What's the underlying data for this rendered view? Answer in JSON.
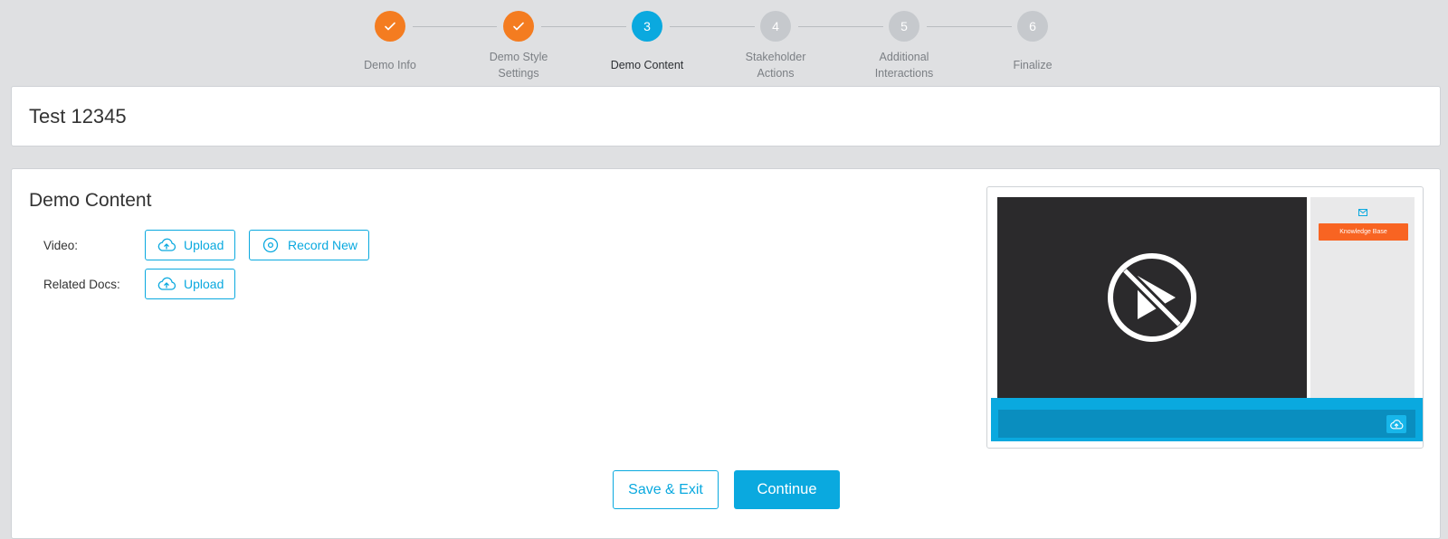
{
  "stepper": {
    "steps": [
      {
        "number": "1",
        "label": "Demo Info",
        "status": "done"
      },
      {
        "number": "2",
        "label": "Demo Style Settings",
        "status": "done"
      },
      {
        "number": "3",
        "label": "Demo Content",
        "status": "active"
      },
      {
        "number": "4",
        "label": "Stakeholder Actions",
        "status": "pending"
      },
      {
        "number": "5",
        "label": "Additional Interactions",
        "status": "pending"
      },
      {
        "number": "6",
        "label": "Finalize",
        "status": "pending"
      }
    ],
    "icons": {
      "done": "check-icon"
    },
    "colors": {
      "done": "#f47c20",
      "active": "#0aa9df",
      "pending": "#c6c9cd"
    }
  },
  "demo": {
    "title": "Test 12345"
  },
  "content": {
    "section_title": "Demo Content",
    "video_label": "Video:",
    "video_upload_label": "Upload",
    "video_record_label": "Record New",
    "docs_label": "Related Docs:",
    "docs_upload_label": "Upload",
    "icons": {
      "upload": "cloud-upload-icon",
      "record": "record-icon"
    }
  },
  "preview": {
    "knowledge_base_label": "Knowledge Base",
    "icons": {
      "video": "no-video-icon",
      "mail": "mail-icon",
      "upload": "cloud-upload-icon"
    },
    "colors": {
      "video_bg": "#2b2a2c",
      "kb_button": "#f86422",
      "bar": "#0aa9df"
    }
  },
  "footer": {
    "save_label": "Save & Exit",
    "continue_label": "Continue"
  },
  "colors": {
    "accent": "#0aa9df",
    "orange": "#f47c20",
    "page_bg": "#dfe0e2"
  }
}
